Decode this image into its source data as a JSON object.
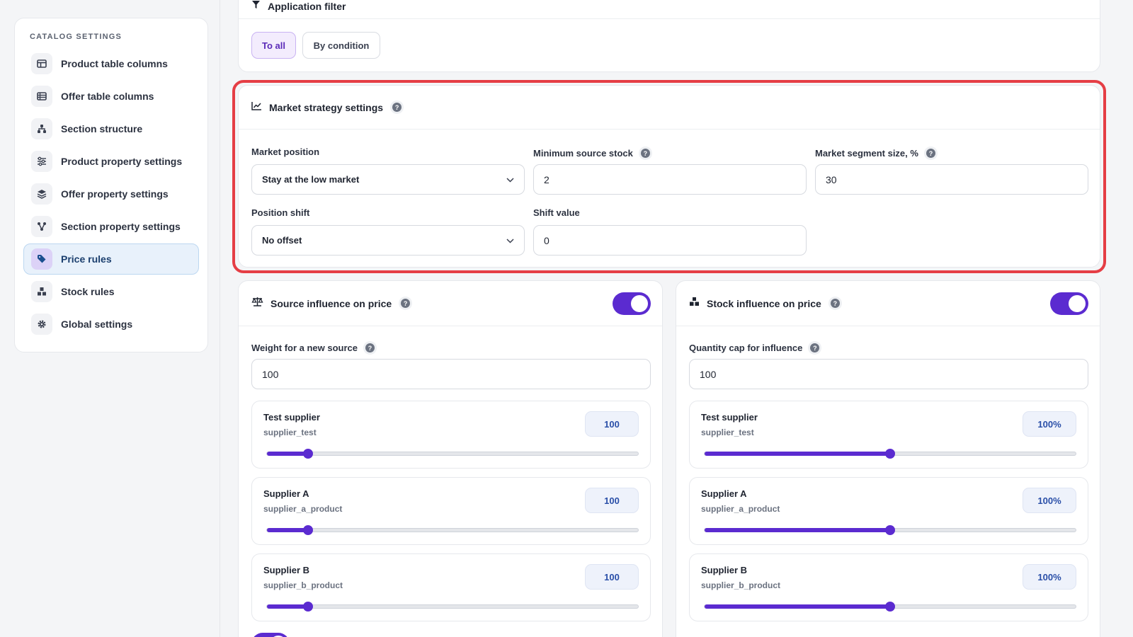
{
  "sidebar": {
    "title": "CATALOG SETTINGS",
    "items": [
      {
        "label": "Product table columns",
        "icon": "columns-icon"
      },
      {
        "label": "Offer table columns",
        "icon": "table-icon"
      },
      {
        "label": "Section structure",
        "icon": "hierarchy-icon"
      },
      {
        "label": "Product property settings",
        "icon": "sliders-icon"
      },
      {
        "label": "Offer property settings",
        "icon": "layers-icon"
      },
      {
        "label": "Section property settings",
        "icon": "nodes-icon"
      },
      {
        "label": "Price rules",
        "icon": "tag-icon",
        "active": true
      },
      {
        "label": "Stock rules",
        "icon": "boxes-icon"
      },
      {
        "label": "Global settings",
        "icon": "gear-icon"
      }
    ]
  },
  "app_filter": {
    "title": "Application filter",
    "options": [
      "To all",
      "By condition"
    ],
    "selected": "To all"
  },
  "market_strategy": {
    "title": "Market strategy settings",
    "market_position_label": "Market position",
    "market_position_value": "Stay at the low market",
    "min_stock_label": "Minimum source stock",
    "min_stock_value": "2",
    "segment_label": "Market segment size, %",
    "segment_value": "30",
    "shift_label": "Position shift",
    "shift_value_selected": "No offset",
    "shift_value_label": "Shift value",
    "shift_value": "0"
  },
  "source_influence": {
    "title": "Source influence on price",
    "enabled": true,
    "weight_label": "Weight for a new source",
    "weight_value": "100",
    "suppliers": [
      {
        "name": "Test supplier",
        "code": "supplier_test",
        "value": "100",
        "level": 0.11
      },
      {
        "name": "Supplier A",
        "code": "supplier_a_product",
        "value": "100",
        "level": 0.11
      },
      {
        "name": "Supplier B",
        "code": "supplier_b_product",
        "value": "100",
        "level": 0.11
      }
    ]
  },
  "stock_influence": {
    "title": "Stock influence on price",
    "enabled": true,
    "cap_label": "Quantity cap for influence",
    "cap_value": "100",
    "suppliers": [
      {
        "name": "Test supplier",
        "code": "supplier_test",
        "value": "100%",
        "level": 0.5
      },
      {
        "name": "Supplier A",
        "code": "supplier_a_product",
        "value": "100%",
        "level": 0.5
      },
      {
        "name": "Supplier B",
        "code": "supplier_b_product",
        "value": "100%",
        "level": 0.5
      }
    ]
  },
  "colors": {
    "accent": "#5b2bd0",
    "highlight": "#e53e45",
    "active_bg": "#e8f1fb"
  }
}
